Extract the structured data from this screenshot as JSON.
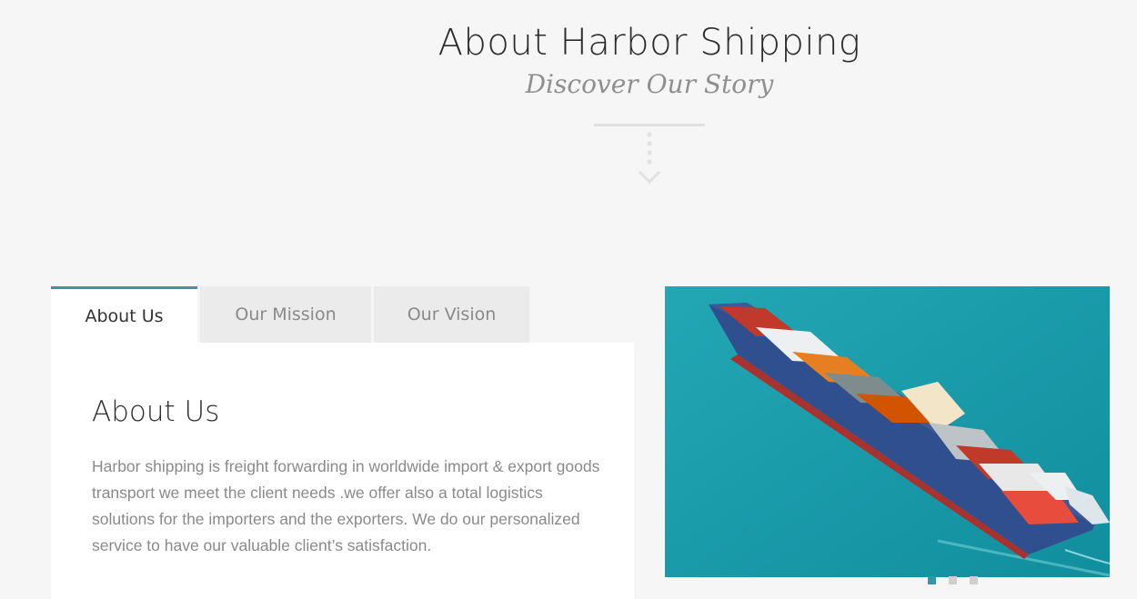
{
  "header": {
    "title": "About Harbor Shipping",
    "subtitle": "Discover Our Story"
  },
  "tabs": [
    {
      "label": "About Us",
      "active": true
    },
    {
      "label": "Our Mission",
      "active": false
    },
    {
      "label": "Our Vision",
      "active": false
    }
  ],
  "panel": {
    "heading": "About Us",
    "text": "Harbor shipping is freight forwarding in worldwide import & export goods transport we meet the client needs .we offer also a total logistics solutions for the importers and the exporters. We do our personalized service to have our valuable client’s satisfaction."
  },
  "colors": {
    "accent": "#3a95a3",
    "sea": "#1a9aaa"
  },
  "slider": {
    "slides": 3,
    "active": 1
  }
}
